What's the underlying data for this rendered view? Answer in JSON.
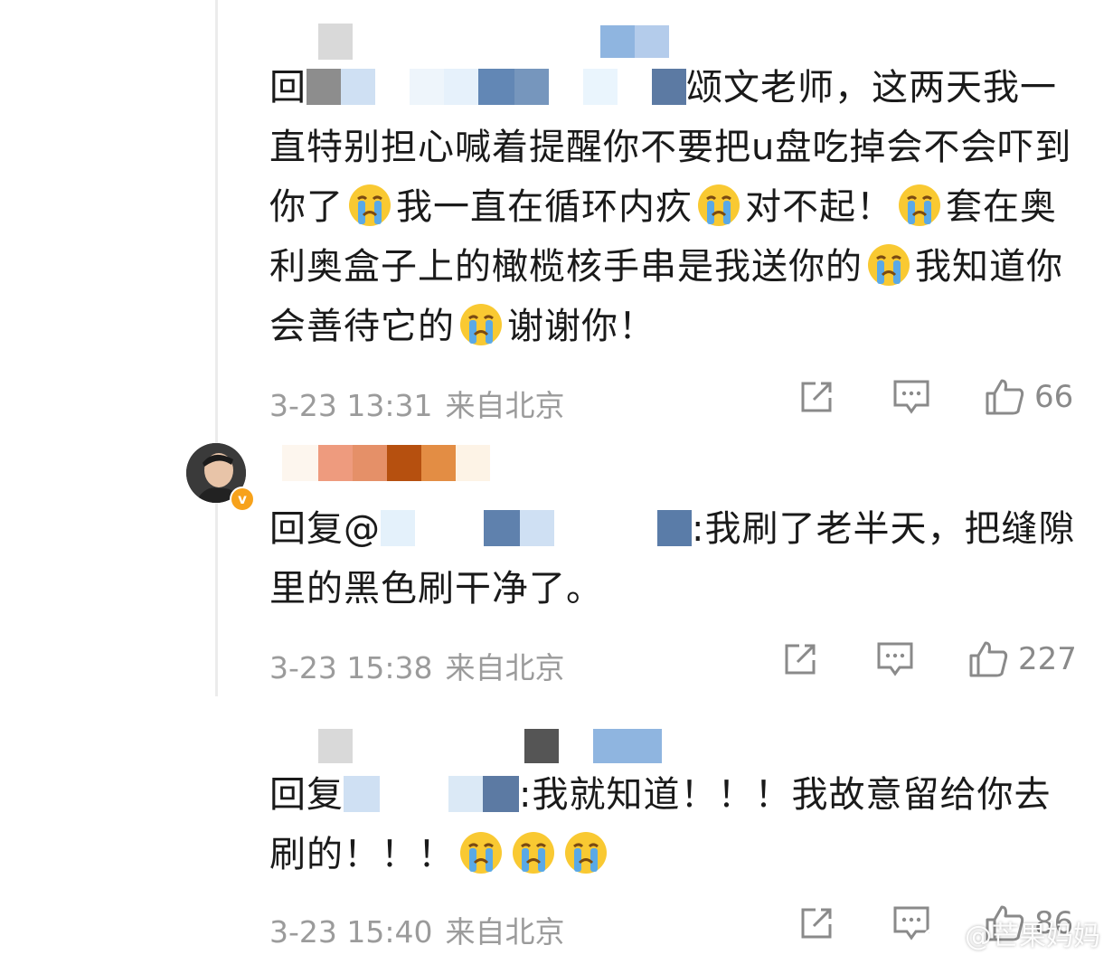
{
  "comments": [
    {
      "reply_prefix": "回",
      "parts": [
        "颂文老师，这两天我一直特别担心喊着提醒你不要把u盘吃掉会不会吓到你了",
        "我一直在循环内疚",
        "对不起！",
        "套在奥利奥盒子上的橄榄核手串是我送你的",
        "我知道你会善待它的",
        "谢谢你！"
      ],
      "time": "3-23 13:31",
      "location": "来自北京",
      "likes": "66"
    },
    {
      "reply_prefix": "回复@",
      "parts": [
        ":我刷了老半天，把缝隙里的黑色刷干净了。"
      ],
      "time": "3-23 15:38",
      "location": "来自北京",
      "likes": "227"
    },
    {
      "reply_prefix": "回复",
      "parts": [
        ":我就知道！！！我故意留给你去刷的！！！"
      ],
      "time": "3-23 15:40",
      "location": "来自北京",
      "likes": "86"
    }
  ],
  "watermark": "@芒果妈妈",
  "icons": [
    "share-icon",
    "comment-icon",
    "like-icon",
    "crying-emoji-icon",
    "verified-badge-icon"
  ],
  "colors": {
    "meta_gray": "#9b9b9b",
    "verified_orange": "#f7a21b",
    "emoji_yellow": "#f9c932",
    "tear_blue": "#5aa9e6"
  }
}
